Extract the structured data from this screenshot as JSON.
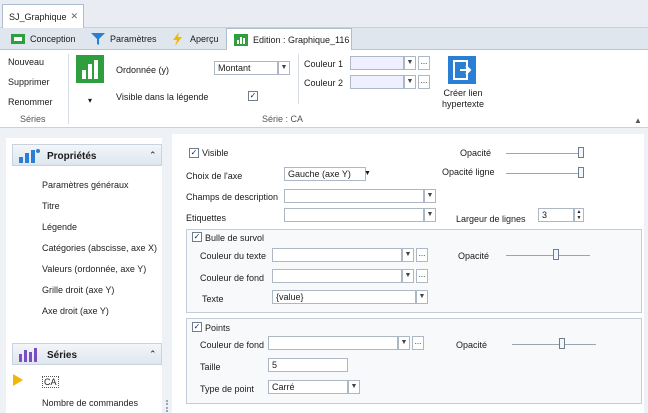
{
  "document_tab": "SJ_Graphique",
  "tabs": [
    {
      "label": "Conception",
      "icon": "design-icon"
    },
    {
      "label": "Paramètres",
      "icon": "filter-icon"
    },
    {
      "label": "Aperçu",
      "icon": "lightning-icon"
    },
    {
      "label": "Edition : Graphique_116",
      "icon": "chart-edit-icon"
    }
  ],
  "ribbon": {
    "series_group": {
      "new": "Nouveau",
      "delete": "Supprimer",
      "rename": "Renommer",
      "label": "Séries"
    },
    "ordinate_label": "Ordonnée (y)",
    "ordinate_value": "Montant",
    "legend_label": "Visible dans la légende",
    "color1_label": "Couleur 1",
    "color2_label": "Couleur 2",
    "link_button": "Créer lien hypertexte",
    "group_label": "Série : CA"
  },
  "left": {
    "props_title": "Propriétés",
    "props_items": [
      "Paramètres généraux",
      "Titre",
      "Légende",
      "Catégories (abscisse, axe X)",
      "Valeurs (ordonnée, axe Y)",
      "Grille droit (axe Y)",
      "Axe droit (axe Y)"
    ],
    "series_title": "Séries",
    "series_items": [
      "CA",
      "Nombre de commandes"
    ]
  },
  "form": {
    "visible": "Visible",
    "axis_label": "Choix de l'axe",
    "axis_value": "Gauche (axe Y)",
    "desc_label": "Champs de description",
    "labels_label": "Etiquettes",
    "opacity_label": "Opacité",
    "line_opacity_label": "Opacité ligne",
    "line_width_label": "Largeur de lignes",
    "line_width_value": "3",
    "tooltip": {
      "title": "Bulle de survol",
      "text_color": "Couleur du texte",
      "bg_color": "Couleur de fond",
      "text": "Texte",
      "text_value": "{value}",
      "opacity": "Opacité"
    },
    "points": {
      "title": "Points",
      "bg_color": "Couleur de fond",
      "size": "Taille",
      "size_value": "5",
      "type": "Type de point",
      "type_value": "Carré",
      "opacity": "Opacité"
    }
  },
  "sliders": {
    "opacity": 1.0,
    "line_opacity": 1.0,
    "tooltip_opacity": 0.6,
    "points_opacity": 0.6
  },
  "colors": {
    "accent_green": "#2e9e3e",
    "accent_blue": "#2a7fd4"
  }
}
